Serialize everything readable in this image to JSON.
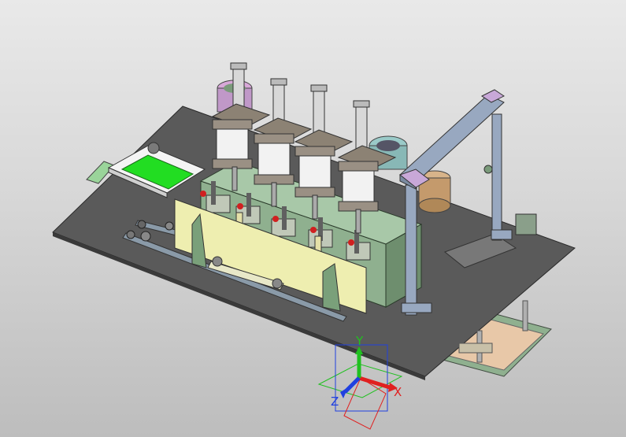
{
  "viewport": {
    "background_top": "#e9e9e9",
    "background_bottom": "#bdbdbd"
  },
  "triad": {
    "x_label": "X",
    "y_label": "Y",
    "z_label": "Z",
    "x_color": "#e02020",
    "y_color": "#20c020",
    "z_color": "#2040e0"
  },
  "model": {
    "plate_color": "#5a5a5a",
    "panel_color": "#eeeeb0",
    "frame_color": "#98a8c0",
    "cylinder_body_color": "#f2f2f2",
    "cylinder_cap_color": "#8c8274",
    "frame_plate_color": "#c8a8d8",
    "guide_color": "#8a9f8a",
    "tray_color": "#22dd22",
    "bowl_color": "#c49a6c"
  }
}
